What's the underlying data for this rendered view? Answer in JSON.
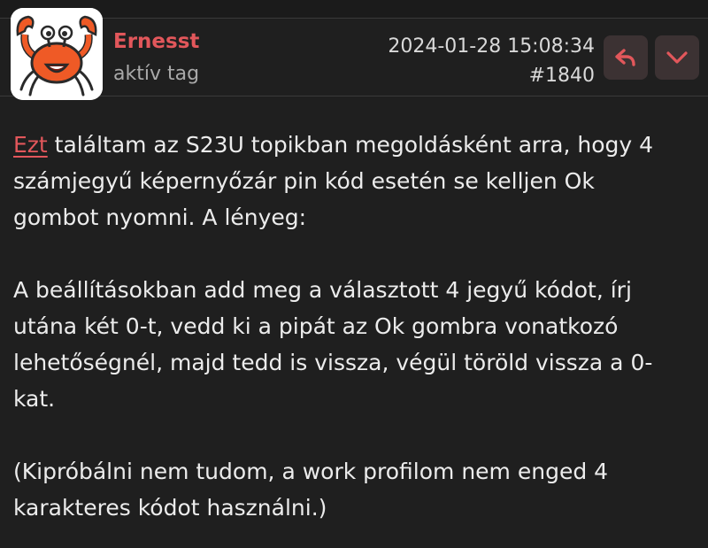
{
  "post": {
    "author": "Ernesst",
    "role": "aktív tag",
    "date": "2024-01-28 15:08:34",
    "number": "#1840",
    "accent_color": "#e2575b",
    "reply_icon": "reply-arrow-icon",
    "more_icon": "chevron-down-icon",
    "avatar_icon": "crab-avatar"
  },
  "body": {
    "p1_link": "Ezt",
    "p1_line1_rest": " találtam az S23U topikban megoldásként arra, hogy 4",
    "p1_line2": "számjegyű képernyőzár pin kód esetén se kelljen Ok",
    "p1_line3": "gombot nyomni. A lényeg:",
    "p2_line1": "A beállításokban add meg a választott 4 jegyű kódot, írj",
    "p2_line2": "utána két 0-t, vedd ki a pipát az Ok gombra vonatkozó",
    "p2_line3": "lehetőségnél, majd tedd is vissza, végül töröld vissza a 0-",
    "p2_line4": "kat.",
    "p3_line1": "(Kipróbálni nem tudom, a work profilom nem enged 4",
    "p3_line2": "karakteres kódot használni.)"
  }
}
